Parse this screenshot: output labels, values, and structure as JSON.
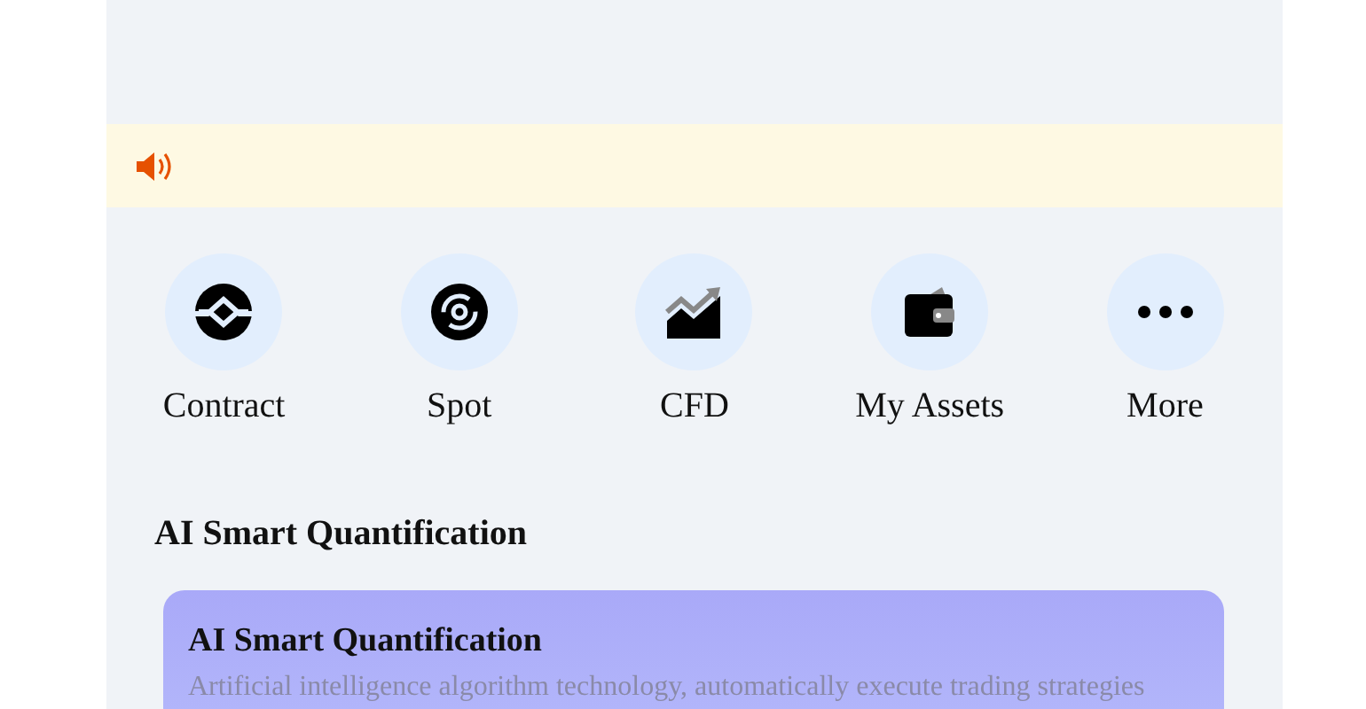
{
  "shortcuts": [
    {
      "label": "Contract"
    },
    {
      "label": "Spot"
    },
    {
      "label": "CFD"
    },
    {
      "label": "My Assets"
    },
    {
      "label": "More"
    }
  ],
  "section": {
    "title": "AI Smart Quantification"
  },
  "card": {
    "title": "AI Smart Quantification",
    "description": "Artificial intelligence algorithm technology, automatically execute trading strategies"
  }
}
